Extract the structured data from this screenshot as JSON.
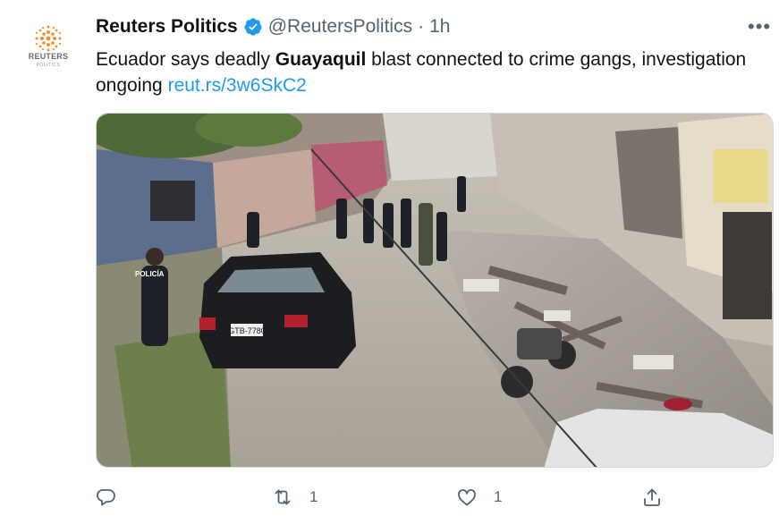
{
  "tweet": {
    "avatar": {
      "wordmark": "REUTERS",
      "subtitle": "POLITICS",
      "icon": "reuters-dot-sphere-logo",
      "color": "#f48c2c"
    },
    "author": {
      "display_name": "Reuters Politics",
      "handle": "@ReutersPolitics",
      "separator": "·",
      "timestamp": "1h",
      "verified_color": "#1d9bf0"
    },
    "more_label": "•••",
    "text": {
      "part1": "Ecuador says deadly ",
      "bold": "Guayaquil",
      "part2": " blast connected to crime gangs, investigation ongoing ",
      "link": "reut.rs/3w6SkC2"
    },
    "media": {
      "plate_text": "GTB-7780",
      "vest_text": "POLICÍA"
    },
    "actions": {
      "reply": {
        "icon": "reply-icon",
        "count": ""
      },
      "retweet": {
        "icon": "retweet-icon",
        "count": "1"
      },
      "like": {
        "icon": "like-icon",
        "count": "1"
      },
      "share": {
        "icon": "share-icon",
        "count": ""
      }
    },
    "accent_color": "#1d9bf0",
    "secondary_text_color": "#536471"
  }
}
